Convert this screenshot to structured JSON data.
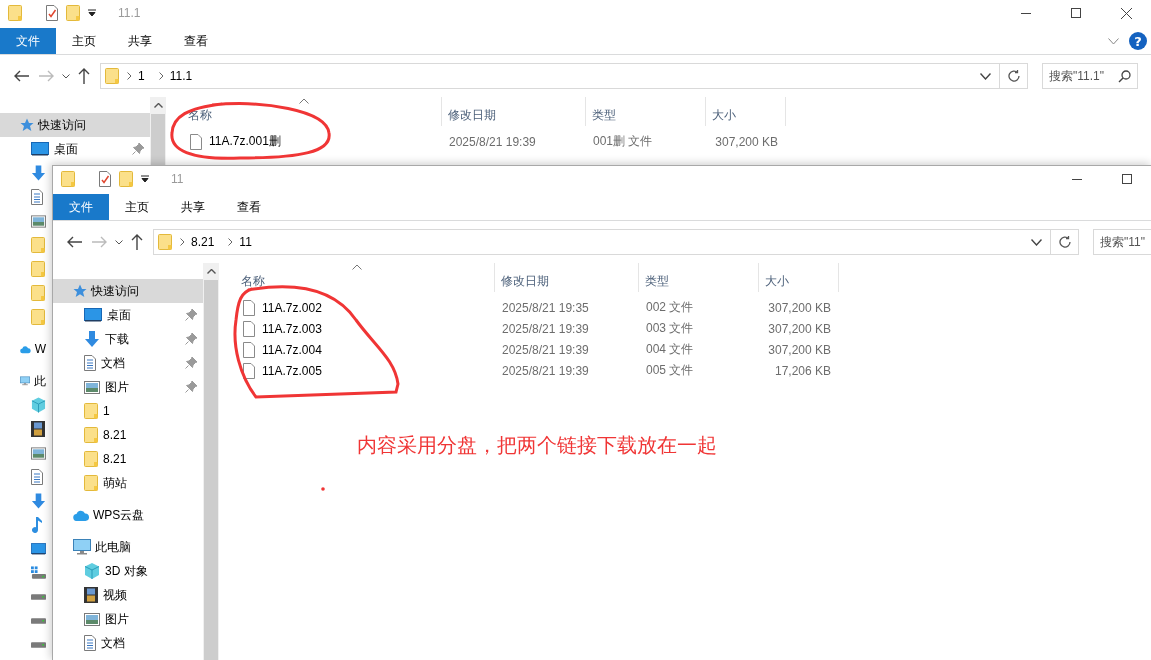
{
  "windows": [
    {
      "title": "11.1",
      "caption_buttons": [
        {
          "kind": "minimize"
        },
        {
          "kind": "maximize"
        },
        {
          "kind": "close"
        }
      ],
      "ribbon": {
        "tabs": [
          {
            "label": "文件",
            "kind": "file"
          },
          {
            "label": "主页",
            "kind": "tab"
          },
          {
            "label": "共享",
            "kind": "tab"
          },
          {
            "label": "查看",
            "kind": "tab"
          }
        ],
        "help_button": {
          "label": "?"
        }
      },
      "address": {
        "path": [
          "1",
          "11.1"
        ],
        "search": {
          "placeholder": "搜索\"11.1\""
        }
      },
      "sidebar": {
        "sections": [
          {
            "label": "快速访问",
            "selected": true,
            "children": [
              {
                "label": "桌面",
                "selected": false,
                "pinned": true
              },
              {
                "selected": false
              },
              {
                "selected": false
              },
              {
                "selected": false
              },
              {
                "selected": false
              },
              {
                "selected": false
              },
              {
                "selected": false
              },
              {
                "selected": false
              }
            ]
          },
          {
            "label": "W",
            "selected": false
          },
          {
            "label": "此",
            "selected": false,
            "children": [
              {
                "selected": false
              },
              {
                "selected": false
              },
              {
                "selected": false
              },
              {
                "selected": false
              },
              {
                "selected": false
              },
              {
                "selected": false
              },
              {
                "selected": false
              },
              {
                "selected": false
              },
              {
                "selected": false
              },
              {
                "selected": false
              },
              {
                "selected": false
              }
            ]
          }
        ]
      },
      "columns": [
        {
          "label": "名称",
          "sorted": true
        },
        {
          "label": "修改日期",
          "sorted": false
        },
        {
          "label": "类型",
          "sorted": false
        },
        {
          "label": "大小",
          "sorted": false
        }
      ],
      "files": [
        {
          "name": "11A.7z.001删",
          "modified": "2025/8/21 19:39",
          "type": "001删 文件",
          "size": "307,200 KB"
        }
      ]
    },
    {
      "title": "11",
      "caption_buttons": [
        {
          "kind": "minimize"
        },
        {
          "kind": "maximize"
        }
      ],
      "ribbon": {
        "tabs": [
          {
            "label": "文件",
            "kind": "file"
          },
          {
            "label": "主页",
            "kind": "tab"
          },
          {
            "label": "共享",
            "kind": "tab"
          },
          {
            "label": "查看",
            "kind": "tab"
          }
        ]
      },
      "address": {
        "path": [
          "8.21",
          "11"
        ],
        "search": {
          "placeholder": "搜索\"11\""
        }
      },
      "sidebar": {
        "sections": [
          {
            "label": "快速访问",
            "selected": true,
            "children": [
              {
                "label": "桌面",
                "selected": false,
                "pinned": true
              },
              {
                "label": "下载",
                "selected": false,
                "pinned": true
              },
              {
                "label": "文档",
                "selected": false,
                "pinned": true
              },
              {
                "label": "图片",
                "selected": false,
                "pinned": true
              },
              {
                "label": "1",
                "selected": false,
                "pinned": false
              },
              {
                "label": "8.21",
                "selected": false,
                "pinned": false
              },
              {
                "label": "8.21",
                "selected": false,
                "pinned": false
              },
              {
                "label": "萌站",
                "selected": false,
                "pinned": false
              }
            ]
          },
          {
            "label": "WPS云盘",
            "selected": false
          },
          {
            "label": "此电脑",
            "selected": false,
            "children": [
              {
                "label": "3D 对象",
                "selected": false
              },
              {
                "label": "视频",
                "selected": false
              },
              {
                "label": "图片",
                "selected": false
              },
              {
                "label": "文档",
                "selected": false
              }
            ]
          }
        ]
      },
      "columns": [
        {
          "label": "名称",
          "sorted": true
        },
        {
          "label": "修改日期",
          "sorted": false
        },
        {
          "label": "类型",
          "sorted": false
        },
        {
          "label": "大小",
          "sorted": false
        }
      ],
      "files": [
        {
          "name": "11A.7z.002",
          "modified": "2025/8/21 19:35",
          "type": "002 文件",
          "size": "307,200 KB"
        },
        {
          "name": "11A.7z.003",
          "modified": "2025/8/21 19:39",
          "type": "003 文件",
          "size": "307,200 KB"
        },
        {
          "name": "11A.7z.004",
          "modified": "2025/8/21 19:39",
          "type": "004 文件",
          "size": "307,200 KB"
        },
        {
          "name": "11A.7z.005",
          "modified": "2025/8/21 19:39",
          "type": "005 文件",
          "size": "17,206 KB"
        }
      ]
    }
  ],
  "annotation": {
    "text": "内容采用分盘，把两个链接下载放在一起"
  }
}
